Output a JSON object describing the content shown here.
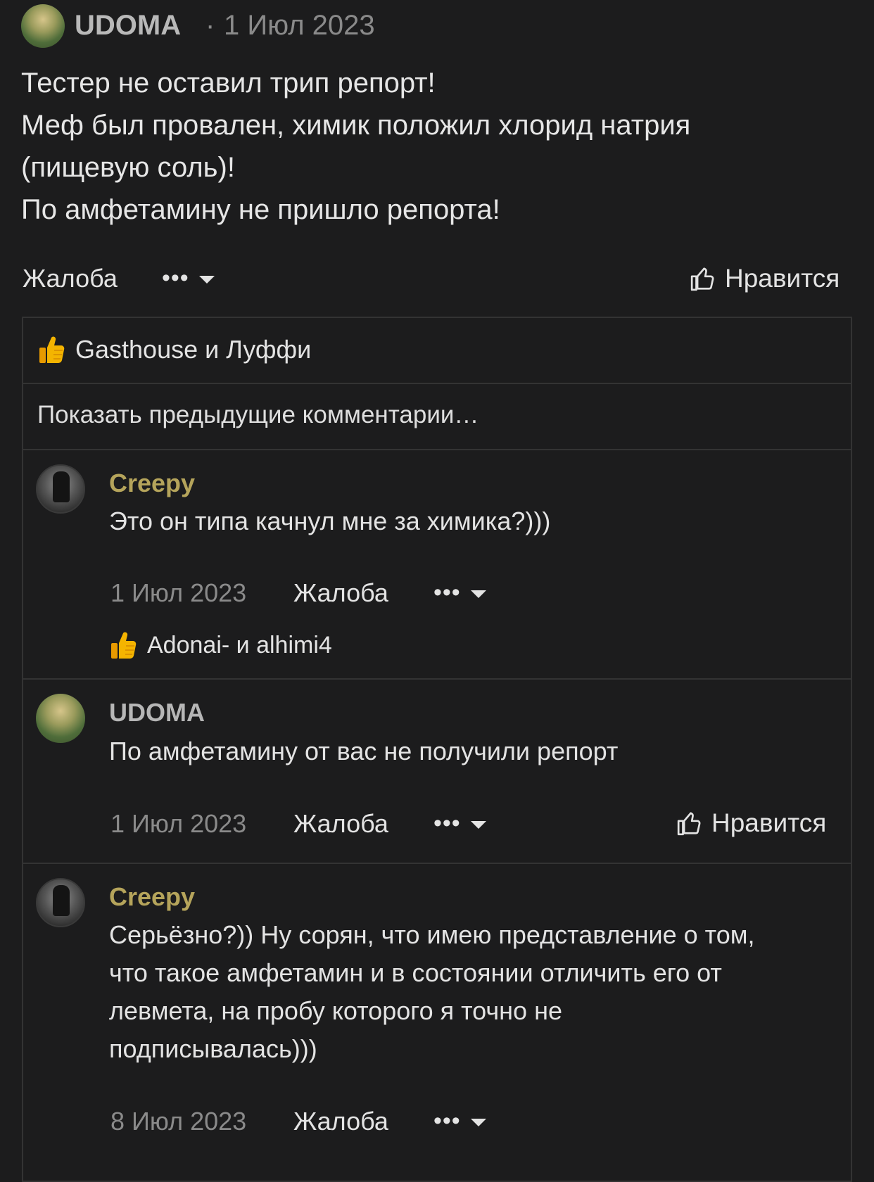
{
  "post": {
    "author": "UDOMA",
    "separator": "·",
    "date": "1 Июл 2023",
    "lines": [
      "Тестер не оставил трип репорт!",
      "Меф был провален, химик положил хлорид натрия",
      "(пищевую соль)!",
      "По амфетамину не пришло репорта!"
    ],
    "report_label": "Жалоба",
    "more_label": "•••",
    "like_label": "Нравится",
    "reactions": "Gasthouse и Луффи"
  },
  "show_previous": "Показать предыдущие комментарии…",
  "comments": [
    {
      "author": "Creepy",
      "lines": [
        "Это он типа качнул мне за химика?)))"
      ],
      "date": "1 Июл 2023",
      "report_label": "Жалоба",
      "more_label": "•••",
      "reactions": "Adonai- и alhimi4"
    },
    {
      "author": "UDOMA",
      "lines": [
        "По амфетамину от вас не получили репорт"
      ],
      "date": "1 Июл 2023",
      "report_label": "Жалоба",
      "more_label": "•••",
      "like_label": "Нравится"
    },
    {
      "author": "Creepy",
      "lines": [
        "Серьёзно?)) Ну сорян, что имею представление о том,",
        "что такое амфетамин и в состоянии отличить его от",
        "левмета, на пробу которого я точно не",
        "подписывалась)))"
      ],
      "date": "8 Июл 2023",
      "report_label": "Жалоба",
      "more_label": "•••"
    }
  ],
  "colors": {
    "background": "#1c1c1d",
    "border": "#333333",
    "creepy_name": "#b5a45b",
    "udoma_name": "#b6b6b6",
    "date": "#8a8a8a",
    "text": "#e3e3e3"
  },
  "icons": {
    "like": "thumbs-up-outline-icon",
    "reaction": "thumbs-up-emoji-icon",
    "menu": "chevron-down-icon"
  }
}
